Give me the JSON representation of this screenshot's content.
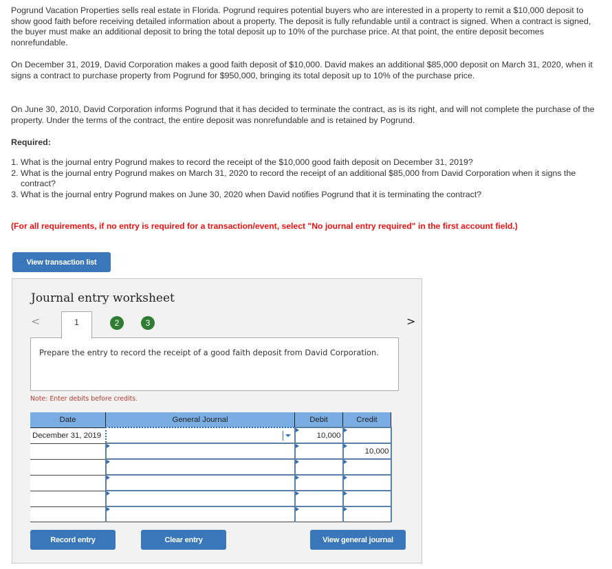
{
  "problem": {
    "paragraphs": [
      "Pogrund Vacation Properties sells real estate in Florida. Pogrund requires potential buyers who are interested in a property to remit a $10,000 deposit to show good faith before receiving detailed information about a property. The deposit is fully refundable until a contract is signed. When a contract is signed, the buyer must make an additional deposit to bring the total deposit up to 10% of the purchase price. At that point, the entire deposit becomes nonrefundable.",
      "On December 31, 2019, David Corporation makes a good faith deposit of $10,000. David makes an additional $85,000 deposit on March 31, 2020, when it signs a contract to purchase property from Pogrund for $950,000, bringing its total deposit up to 10% of the purchase price.",
      "On June 30, 2010, David Corporation informs Pogrund that it has decided to terminate the contract, as is its right, and will not complete the purchase of the property. Under the terms of the contract, the entire deposit was nonrefundable and is retained by Pogrund."
    ],
    "required_title": "Required:",
    "questions": [
      "What is the journal entry Pogrund makes to record the receipt of the $10,000 good faith deposit on December 31, 2019?",
      "What is the journal entry Pogrund makes on March 31, 2020 to record the receipt of an additional $85,000 from David Corporation when it signs the contract?",
      "What is the journal entry Pogrund makes on June 30, 2020 when David notifies Pogrund that it is terminating the contract?"
    ],
    "instruction": "(For all requirements, if no entry is required for a transaction/event, select \"No journal entry required\" in the first account field.)"
  },
  "buttons": {
    "view_transaction_list": "View transaction list",
    "record_entry": "Record entry",
    "clear_entry": "Clear entry",
    "view_general_journal": "View general journal"
  },
  "worksheet": {
    "title": "Journal entry worksheet",
    "prev_icon": "<",
    "next_icon": ">",
    "tabs": [
      {
        "label": "1",
        "state": "active"
      },
      {
        "label": "2",
        "state": "complete"
      },
      {
        "label": "3",
        "state": "complete"
      }
    ],
    "description": "Prepare the entry to record the receipt of a good faith deposit from David Corporation.",
    "note": "Note: Enter debits before credits.",
    "table": {
      "headers": [
        "Date",
        "General Journal",
        "Debit",
        "Credit"
      ],
      "rows": [
        {
          "date": "December 31, 2019",
          "account": "",
          "debit": "10,000",
          "credit": ""
        },
        {
          "date": "",
          "account": "",
          "debit": "",
          "credit": "10,000"
        },
        {
          "date": "",
          "account": "",
          "debit": "",
          "credit": ""
        },
        {
          "date": "",
          "account": "",
          "debit": "",
          "credit": ""
        },
        {
          "date": "",
          "account": "",
          "debit": "",
          "credit": ""
        },
        {
          "date": "",
          "account": "",
          "debit": "",
          "credit": ""
        }
      ]
    }
  },
  "colors": {
    "button_blue": "#3a76ba",
    "header_blue": "#7aaee3",
    "instruction_red": "#ee1111",
    "step_green": "#2e7d32"
  }
}
